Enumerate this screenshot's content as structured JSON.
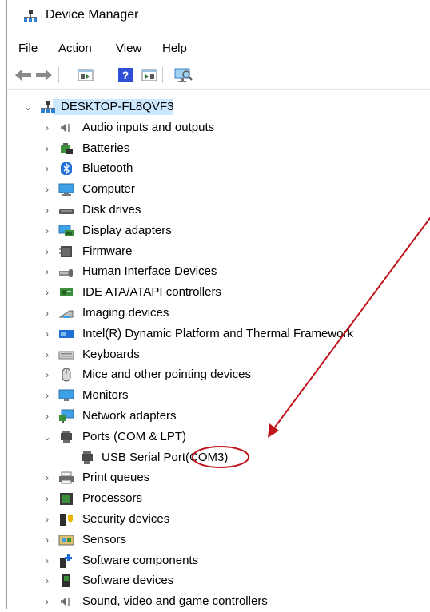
{
  "window": {
    "title": "Device Manager"
  },
  "menu": [
    "File",
    "Action",
    "View",
    "Help"
  ],
  "toolbar": {
    "buttons": [
      "back-icon",
      "forward-icon",
      "properties-icon",
      "help-icon",
      "update-driver-icon",
      "scan-hardware-icon"
    ],
    "help_glyph": "?"
  },
  "tree": {
    "root": "DESKTOP-FL8QVF3",
    "categories": [
      {
        "label": "Audio inputs and outputs",
        "icon": "speaker-icon"
      },
      {
        "label": "Batteries",
        "icon": "battery-icon"
      },
      {
        "label": "Bluetooth",
        "icon": "bluetooth-icon"
      },
      {
        "label": "Computer",
        "icon": "computer-icon"
      },
      {
        "label": "Disk drives",
        "icon": "disk-drive-icon"
      },
      {
        "label": "Display adapters",
        "icon": "display-adapter-icon"
      },
      {
        "label": "Firmware",
        "icon": "firmware-icon"
      },
      {
        "label": "Human Interface Devices",
        "icon": "hid-icon"
      },
      {
        "label": "IDE ATA/ATAPI controllers",
        "icon": "ide-controller-icon"
      },
      {
        "label": "Imaging devices",
        "icon": "camera-icon"
      },
      {
        "label": "Intel(R) Dynamic Platform and Thermal Framework",
        "icon": "intel-thermal-icon"
      },
      {
        "label": "Keyboards",
        "icon": "keyboard-icon"
      },
      {
        "label": "Mice and other pointing devices",
        "icon": "mouse-icon"
      },
      {
        "label": "Monitors",
        "icon": "monitor-icon"
      },
      {
        "label": "Network adapters",
        "icon": "network-adapter-icon"
      },
      {
        "label": "Ports (COM & LPT)",
        "icon": "port-icon",
        "expanded": true,
        "children": [
          {
            "label": "USB Serial Port",
            "suffix": "(COM3)",
            "icon": "port-icon"
          }
        ]
      },
      {
        "label": "Print queues",
        "icon": "printer-icon"
      },
      {
        "label": "Processors",
        "icon": "processor-icon"
      },
      {
        "label": "Security devices",
        "icon": "security-device-icon"
      },
      {
        "label": "Sensors",
        "icon": "sensor-icon"
      },
      {
        "label": "Software components",
        "icon": "software-component-icon"
      },
      {
        "label": "Software devices",
        "icon": "software-device-icon"
      },
      {
        "label": "Sound, video and game controllers",
        "icon": "sound-controller-icon"
      }
    ]
  },
  "annotation": {
    "color": "#c0141c"
  },
  "chevrons": {
    "collapsed": "›",
    "expanded": "⌄"
  }
}
